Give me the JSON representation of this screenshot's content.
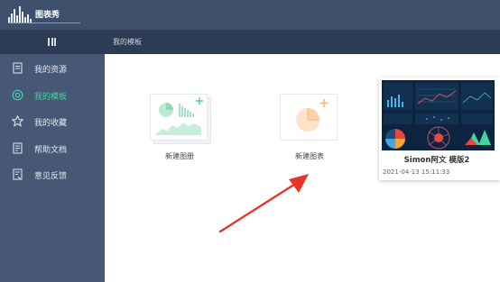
{
  "app": {
    "name": "图表秀"
  },
  "header": {
    "breadcrumb": "我的模板"
  },
  "sidebar": {
    "items": [
      {
        "label": "我的资源",
        "icon": "document-icon",
        "active": false
      },
      {
        "label": "我的模板",
        "icon": "target-icon",
        "active": true
      },
      {
        "label": "我的收藏",
        "icon": "star-icon",
        "active": false
      },
      {
        "label": "帮助文档",
        "icon": "help-document-icon",
        "active": false
      },
      {
        "label": "意见反馈",
        "icon": "feedback-icon",
        "active": false
      }
    ]
  },
  "main": {
    "create_album_label": "新建图册",
    "create_chart_label": "新建图表",
    "template": {
      "title": "Simon阿文  模版2",
      "date": "2021-04-13 15:11:33"
    }
  },
  "colors": {
    "topbar": "#3e4f6c",
    "subbar": "#2e3b55",
    "sidebar": "#465875",
    "accent": "#3fd6a0",
    "arrow": "#e8342a"
  }
}
